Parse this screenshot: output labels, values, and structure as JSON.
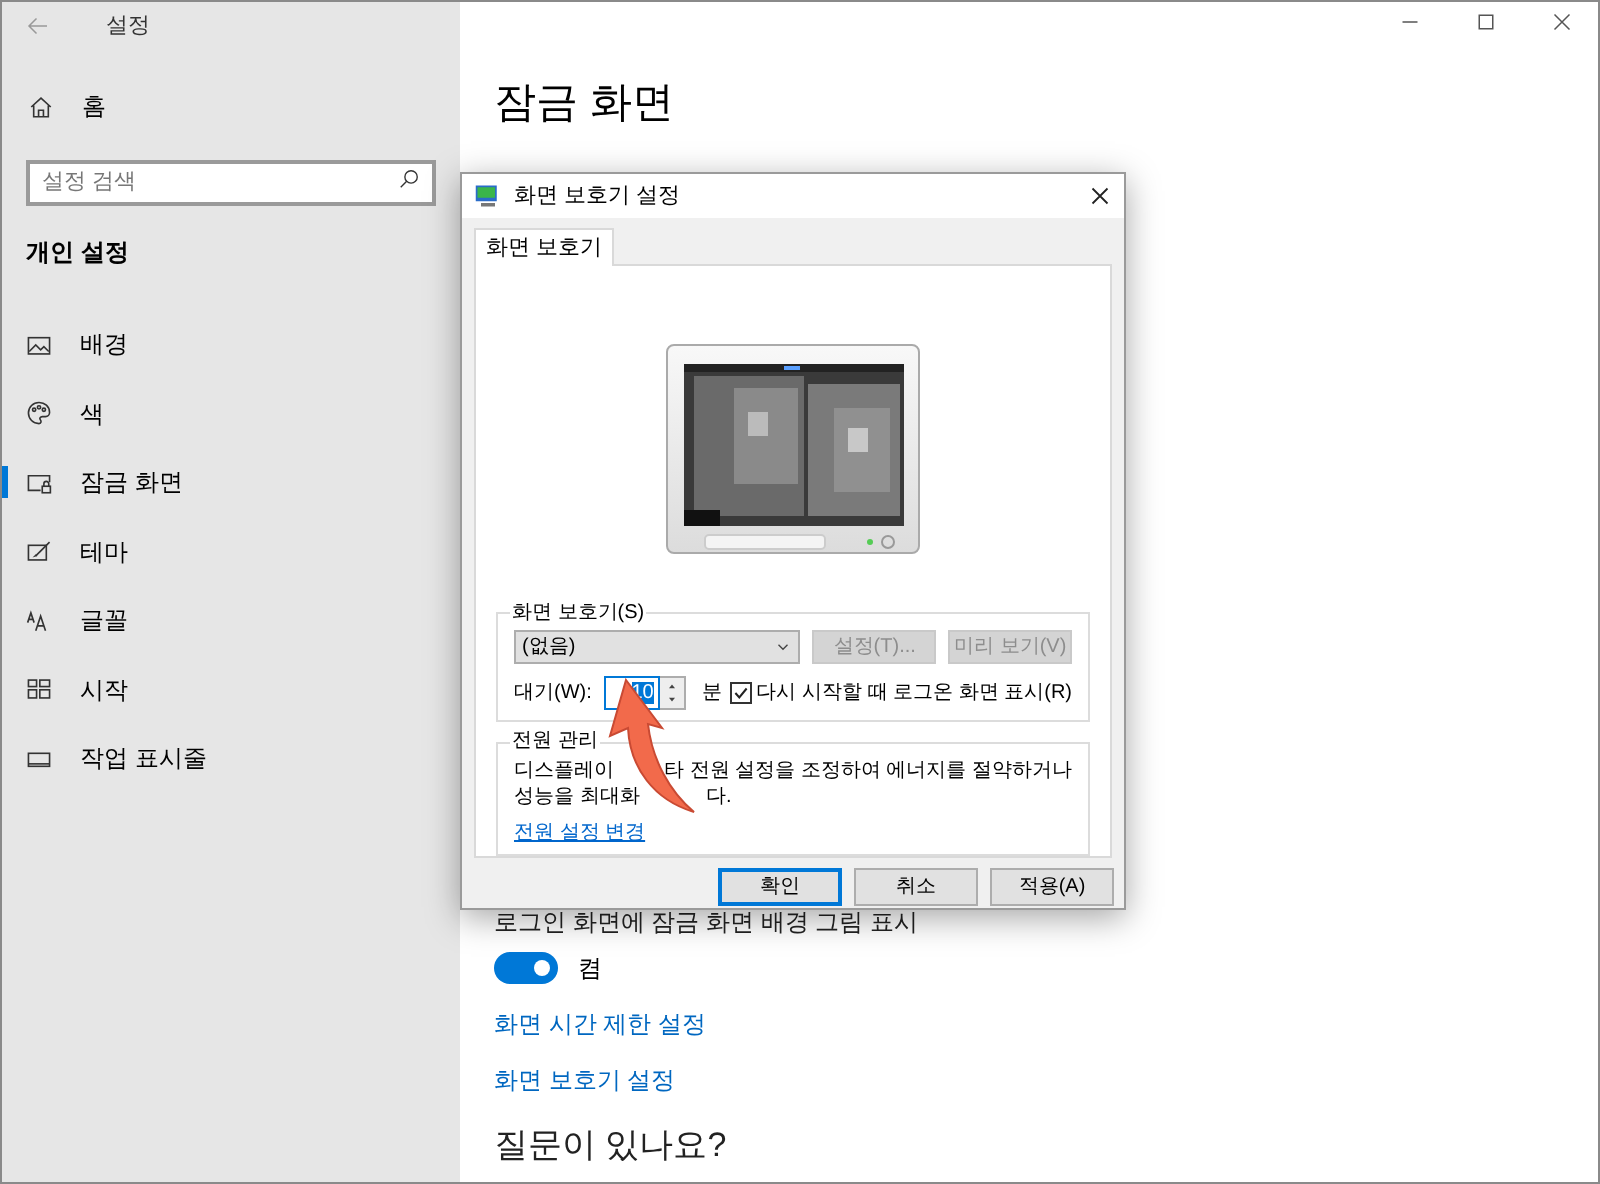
{
  "window": {
    "title": "설정"
  },
  "sidebar": {
    "home": "홈",
    "search": {
      "placeholder": "설정 검색"
    },
    "section": "개인 설정",
    "items": [
      {
        "label": "배경",
        "selected": false
      },
      {
        "label": "색",
        "selected": false
      },
      {
        "label": "잠금 화면",
        "selected": true
      },
      {
        "label": "테마",
        "selected": false
      },
      {
        "label": "글꼴",
        "selected": false
      },
      {
        "label": "시작",
        "selected": false
      },
      {
        "label": "작업 표시줄",
        "selected": false
      }
    ]
  },
  "main": {
    "title": "잠금 화면",
    "show_background_label": "로그인 화면에 잠금 화면 배경 그림 표시",
    "toggle": {
      "on": true,
      "label": "켬"
    },
    "links": [
      "화면 시간 제한 설정",
      "화면 보호기 설정"
    ],
    "help_heading": "질문이 있나요?"
  },
  "dialog": {
    "title": "화면 보호기 설정",
    "tabs": [
      {
        "label": "화면 보호기",
        "selected": true
      }
    ],
    "screensaver_group": {
      "title": "화면 보호기(S)",
      "select": {
        "value": "(없음)"
      },
      "buttons": [
        {
          "label": "설정(T)...",
          "disabled": true
        },
        {
          "label": "미리 보기(V)",
          "disabled": true
        }
      ],
      "wait_label": "대기(W):",
      "wait_value": "10",
      "wait_unit": "분",
      "checkbox": {
        "label": "다시 시작할 때 로그온 화면 표시(R)",
        "checked": true
      }
    },
    "power_group": {
      "title": "전원 관리",
      "line1_start": "디스플레이",
      "line1_end": "타 전원 설정을 조정하여 에너지를 절약하거나",
      "line2_start": "성능을 최대화",
      "line2_end": "다.",
      "link": "전원 설정 변경"
    },
    "buttons": [
      {
        "label": "확인",
        "default": true
      },
      {
        "label": "취소",
        "default": false
      },
      {
        "label": "적용(A)",
        "default": false
      }
    ]
  }
}
